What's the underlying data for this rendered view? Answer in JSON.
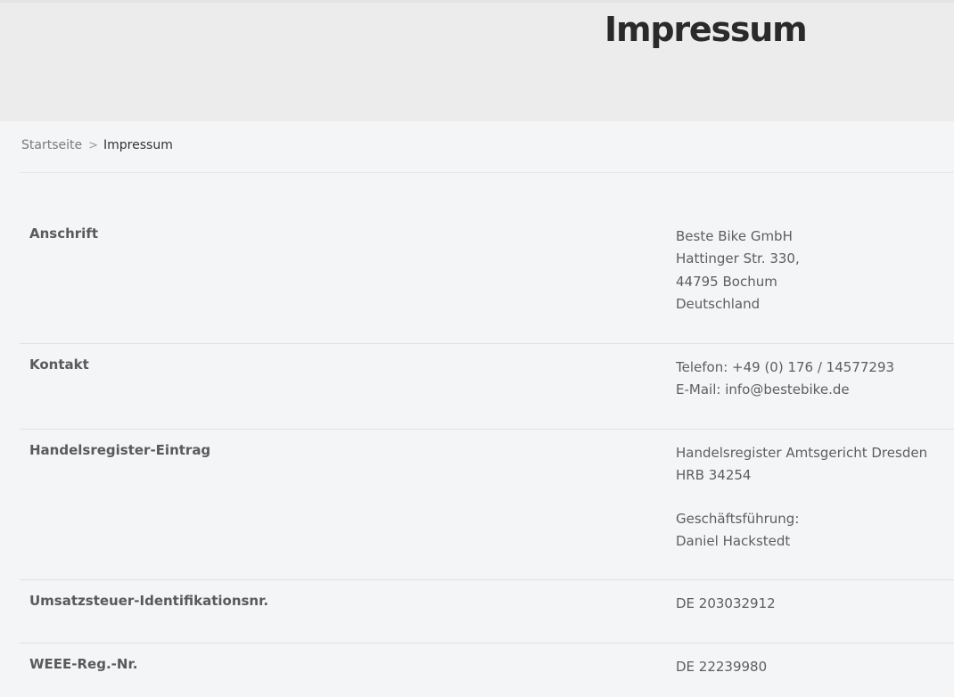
{
  "header": {
    "title": "Impressum"
  },
  "breadcrumb": {
    "home": "Startseite",
    "separator": ">",
    "current": "Impressum"
  },
  "rows": {
    "anschrift": {
      "label": "Anschrift",
      "lines": [
        "Beste Bike GmbH",
        "Hattinger Str. 330,",
        "44795 Bochum",
        "Deutschland"
      ]
    },
    "kontakt": {
      "label": "Kontakt",
      "phone": "Telefon: +49 (0) 176 / 14577293",
      "email_prefix": "E-Mail: ",
      "email": "info@bestebike.de"
    },
    "handelsregister": {
      "label": "Handelsregister-Eintrag",
      "court": "Handelsregister Amtsgericht Dresden",
      "number": "HRB 34254",
      "management_label": "Geschäftsführung:",
      "management_name": "Daniel Hackstedt"
    },
    "ust": {
      "label": "Umsatzsteuer-Identifikationsnr.",
      "value": "DE 203032912"
    },
    "weee": {
      "label": "WEEE-Reg.-Nr.",
      "value": "DE 22239980"
    }
  }
}
